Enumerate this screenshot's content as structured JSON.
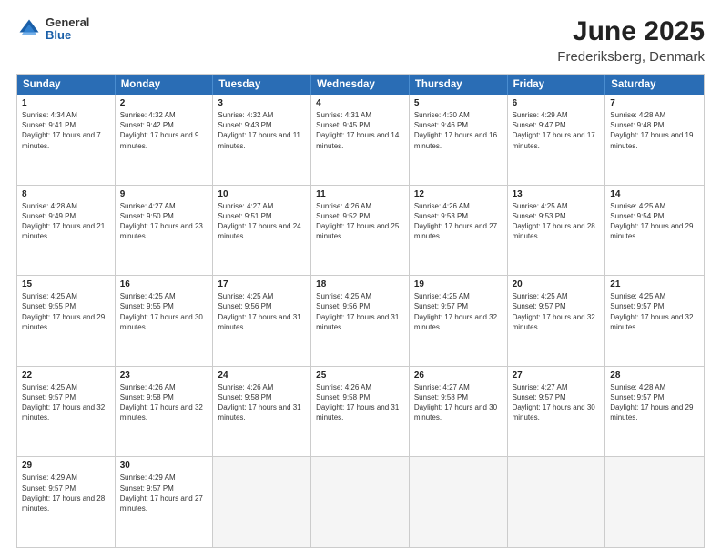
{
  "header": {
    "logo": {
      "general": "General",
      "blue": "Blue"
    },
    "title": "June 2025",
    "subtitle": "Frederiksberg, Denmark"
  },
  "calendar": {
    "days_of_week": [
      "Sunday",
      "Monday",
      "Tuesday",
      "Wednesday",
      "Thursday",
      "Friday",
      "Saturday"
    ],
    "weeks": [
      [
        {
          "day": "1",
          "sunrise": "Sunrise: 4:34 AM",
          "sunset": "Sunset: 9:41 PM",
          "daylight": "Daylight: 17 hours and 7 minutes."
        },
        {
          "day": "2",
          "sunrise": "Sunrise: 4:32 AM",
          "sunset": "Sunset: 9:42 PM",
          "daylight": "Daylight: 17 hours and 9 minutes."
        },
        {
          "day": "3",
          "sunrise": "Sunrise: 4:32 AM",
          "sunset": "Sunset: 9:43 PM",
          "daylight": "Daylight: 17 hours and 11 minutes."
        },
        {
          "day": "4",
          "sunrise": "Sunrise: 4:31 AM",
          "sunset": "Sunset: 9:45 PM",
          "daylight": "Daylight: 17 hours and 14 minutes."
        },
        {
          "day": "5",
          "sunrise": "Sunrise: 4:30 AM",
          "sunset": "Sunset: 9:46 PM",
          "daylight": "Daylight: 17 hours and 16 minutes."
        },
        {
          "day": "6",
          "sunrise": "Sunrise: 4:29 AM",
          "sunset": "Sunset: 9:47 PM",
          "daylight": "Daylight: 17 hours and 17 minutes."
        },
        {
          "day": "7",
          "sunrise": "Sunrise: 4:28 AM",
          "sunset": "Sunset: 9:48 PM",
          "daylight": "Daylight: 17 hours and 19 minutes."
        }
      ],
      [
        {
          "day": "8",
          "sunrise": "Sunrise: 4:28 AM",
          "sunset": "Sunset: 9:49 PM",
          "daylight": "Daylight: 17 hours and 21 minutes."
        },
        {
          "day": "9",
          "sunrise": "Sunrise: 4:27 AM",
          "sunset": "Sunset: 9:50 PM",
          "daylight": "Daylight: 17 hours and 23 minutes."
        },
        {
          "day": "10",
          "sunrise": "Sunrise: 4:27 AM",
          "sunset": "Sunset: 9:51 PM",
          "daylight": "Daylight: 17 hours and 24 minutes."
        },
        {
          "day": "11",
          "sunrise": "Sunrise: 4:26 AM",
          "sunset": "Sunset: 9:52 PM",
          "daylight": "Daylight: 17 hours and 25 minutes."
        },
        {
          "day": "12",
          "sunrise": "Sunrise: 4:26 AM",
          "sunset": "Sunset: 9:53 PM",
          "daylight": "Daylight: 17 hours and 27 minutes."
        },
        {
          "day": "13",
          "sunrise": "Sunrise: 4:25 AM",
          "sunset": "Sunset: 9:53 PM",
          "daylight": "Daylight: 17 hours and 28 minutes."
        },
        {
          "day": "14",
          "sunrise": "Sunrise: 4:25 AM",
          "sunset": "Sunset: 9:54 PM",
          "daylight": "Daylight: 17 hours and 29 minutes."
        }
      ],
      [
        {
          "day": "15",
          "sunrise": "Sunrise: 4:25 AM",
          "sunset": "Sunset: 9:55 PM",
          "daylight": "Daylight: 17 hours and 29 minutes."
        },
        {
          "day": "16",
          "sunrise": "Sunrise: 4:25 AM",
          "sunset": "Sunset: 9:55 PM",
          "daylight": "Daylight: 17 hours and 30 minutes."
        },
        {
          "day": "17",
          "sunrise": "Sunrise: 4:25 AM",
          "sunset": "Sunset: 9:56 PM",
          "daylight": "Daylight: 17 hours and 31 minutes."
        },
        {
          "day": "18",
          "sunrise": "Sunrise: 4:25 AM",
          "sunset": "Sunset: 9:56 PM",
          "daylight": "Daylight: 17 hours and 31 minutes."
        },
        {
          "day": "19",
          "sunrise": "Sunrise: 4:25 AM",
          "sunset": "Sunset: 9:57 PM",
          "daylight": "Daylight: 17 hours and 32 minutes."
        },
        {
          "day": "20",
          "sunrise": "Sunrise: 4:25 AM",
          "sunset": "Sunset: 9:57 PM",
          "daylight": "Daylight: 17 hours and 32 minutes."
        },
        {
          "day": "21",
          "sunrise": "Sunrise: 4:25 AM",
          "sunset": "Sunset: 9:57 PM",
          "daylight": "Daylight: 17 hours and 32 minutes."
        }
      ],
      [
        {
          "day": "22",
          "sunrise": "Sunrise: 4:25 AM",
          "sunset": "Sunset: 9:57 PM",
          "daylight": "Daylight: 17 hours and 32 minutes."
        },
        {
          "day": "23",
          "sunrise": "Sunrise: 4:26 AM",
          "sunset": "Sunset: 9:58 PM",
          "daylight": "Daylight: 17 hours and 32 minutes."
        },
        {
          "day": "24",
          "sunrise": "Sunrise: 4:26 AM",
          "sunset": "Sunset: 9:58 PM",
          "daylight": "Daylight: 17 hours and 31 minutes."
        },
        {
          "day": "25",
          "sunrise": "Sunrise: 4:26 AM",
          "sunset": "Sunset: 9:58 PM",
          "daylight": "Daylight: 17 hours and 31 minutes."
        },
        {
          "day": "26",
          "sunrise": "Sunrise: 4:27 AM",
          "sunset": "Sunset: 9:58 PM",
          "daylight": "Daylight: 17 hours and 30 minutes."
        },
        {
          "day": "27",
          "sunrise": "Sunrise: 4:27 AM",
          "sunset": "Sunset: 9:57 PM",
          "daylight": "Daylight: 17 hours and 30 minutes."
        },
        {
          "day": "28",
          "sunrise": "Sunrise: 4:28 AM",
          "sunset": "Sunset: 9:57 PM",
          "daylight": "Daylight: 17 hours and 29 minutes."
        }
      ],
      [
        {
          "day": "29",
          "sunrise": "Sunrise: 4:29 AM",
          "sunset": "Sunset: 9:57 PM",
          "daylight": "Daylight: 17 hours and 28 minutes."
        },
        {
          "day": "30",
          "sunrise": "Sunrise: 4:29 AM",
          "sunset": "Sunset: 9:57 PM",
          "daylight": "Daylight: 17 hours and 27 minutes."
        },
        {
          "day": "",
          "sunrise": "",
          "sunset": "",
          "daylight": ""
        },
        {
          "day": "",
          "sunrise": "",
          "sunset": "",
          "daylight": ""
        },
        {
          "day": "",
          "sunrise": "",
          "sunset": "",
          "daylight": ""
        },
        {
          "day": "",
          "sunrise": "",
          "sunset": "",
          "daylight": ""
        },
        {
          "day": "",
          "sunrise": "",
          "sunset": "",
          "daylight": ""
        }
      ]
    ]
  }
}
